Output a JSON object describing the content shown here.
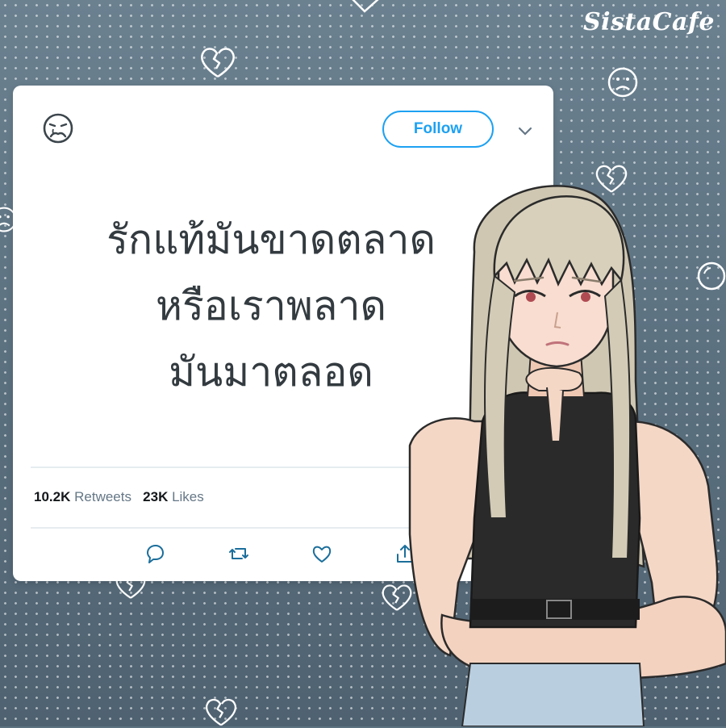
{
  "brand": {
    "logo_text": "SistaCafe"
  },
  "tweet": {
    "avatar_icon": "sad-face-icon",
    "follow_label": "Follow",
    "menu_icon": "chevron-down-icon",
    "lines": [
      "รักแท้มันขาดตลาด",
      "หรือเราพลาด",
      "มันมาตลอด"
    ],
    "retweets_count": "10.2K",
    "retweets_label": "Retweets",
    "likes_count": "23K",
    "likes_label": "Likes",
    "actions": [
      "reply-icon",
      "retweet-icon",
      "like-icon",
      "share-icon"
    ]
  },
  "colors": {
    "background": "#5d7382",
    "card": "#ffffff",
    "accent": "#1da1f2",
    "text": "#333b40"
  }
}
